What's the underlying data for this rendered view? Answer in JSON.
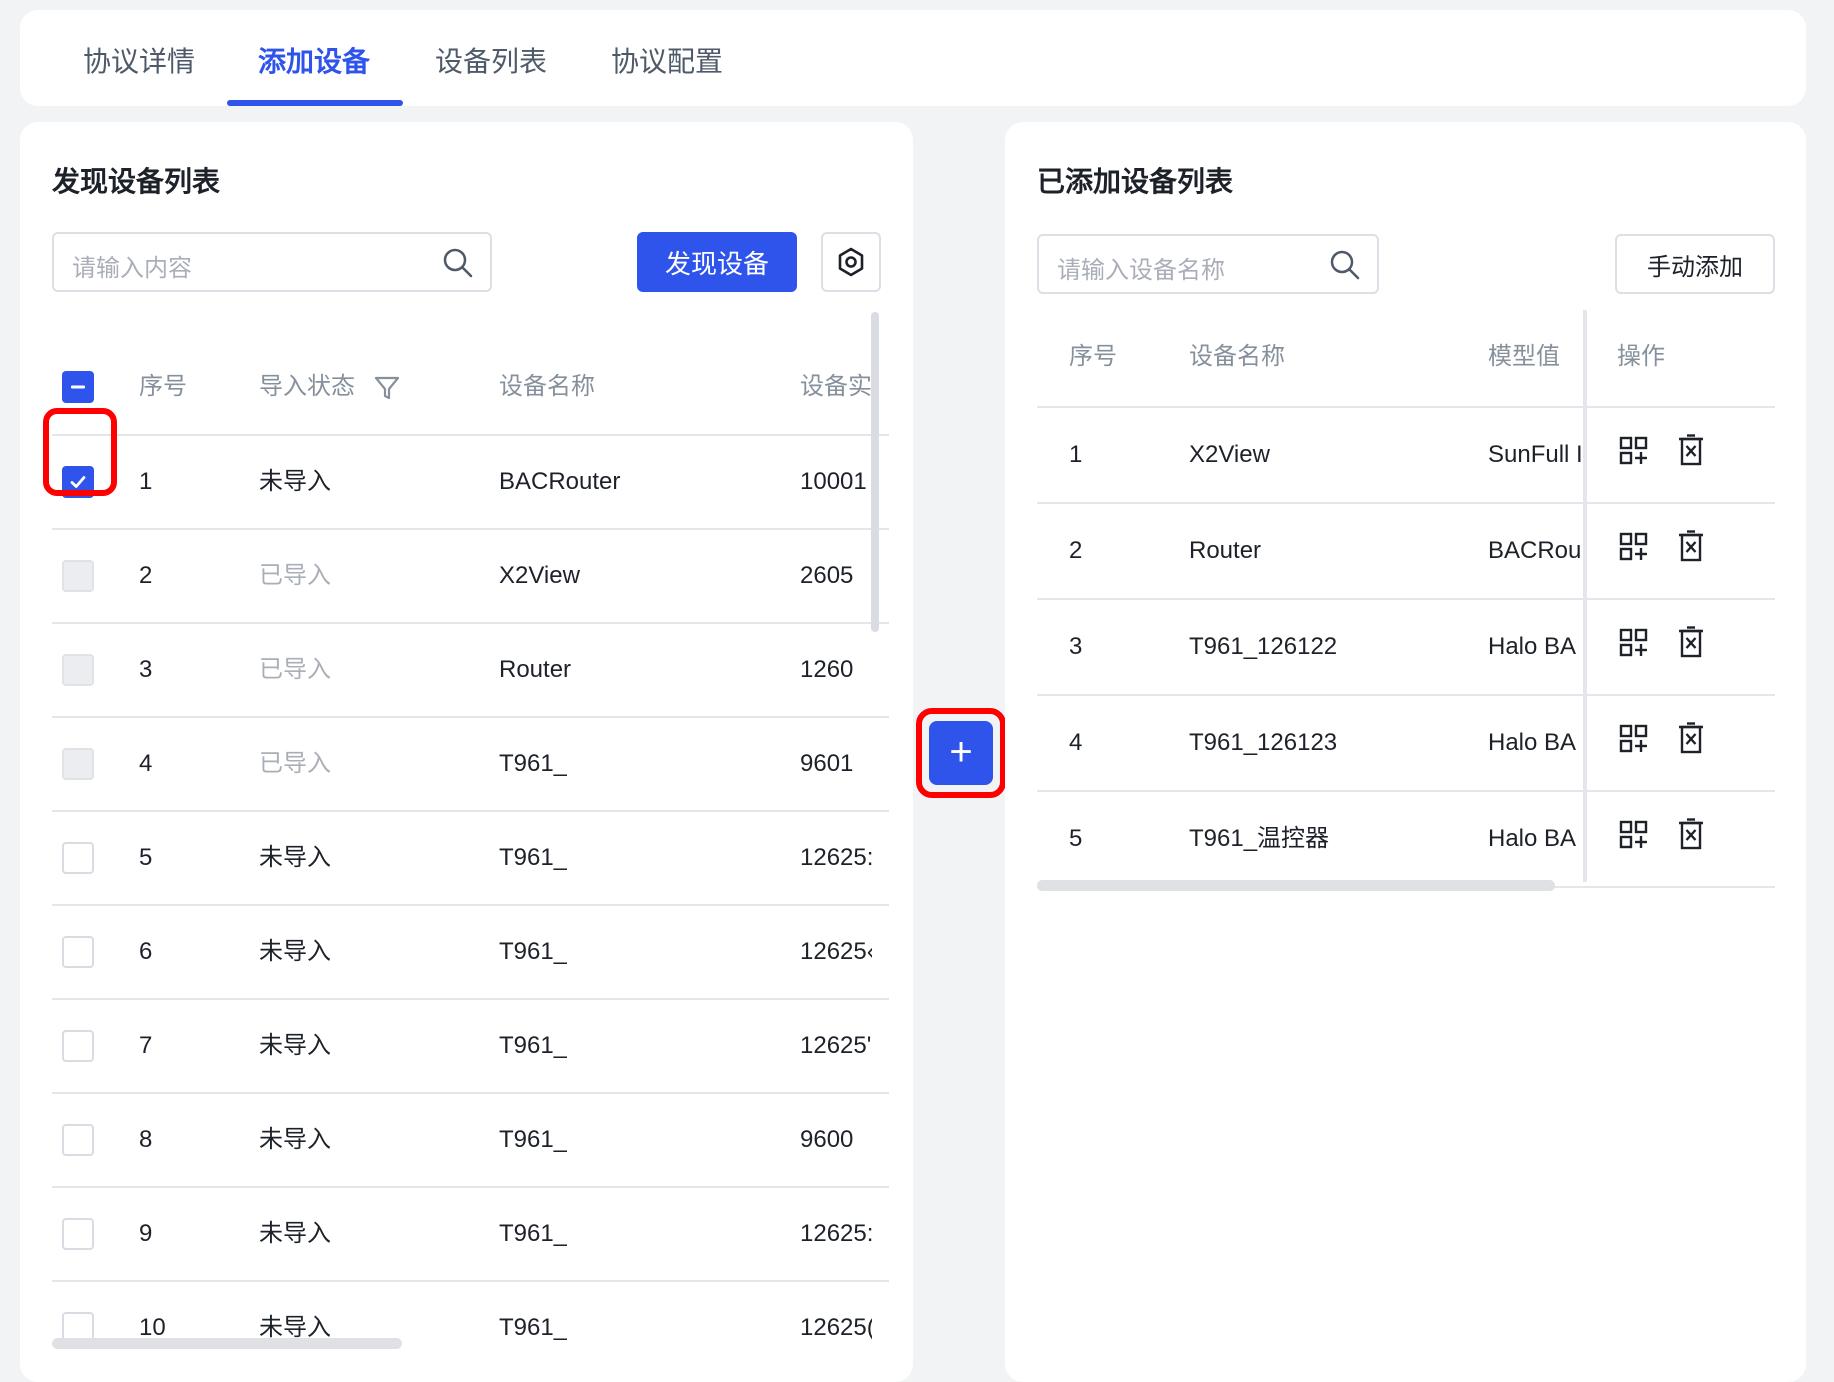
{
  "tabs": [
    {
      "label": "协议详情",
      "active": false
    },
    {
      "label": "添加设备",
      "active": true
    },
    {
      "label": "设备列表",
      "active": false
    },
    {
      "label": "协议配置",
      "active": false
    }
  ],
  "left_panel": {
    "title": "发现设备列表",
    "search_placeholder": "请输入内容",
    "discover_button": "发现设备",
    "settings_icon": "settings-hexagon-icon",
    "columns": [
      "序号",
      "导入状态",
      "设备名称",
      "设备实"
    ],
    "rows": [
      {
        "index": "1",
        "status": "未导入",
        "name": "BACRouter",
        "instance": "10001",
        "checked": true,
        "disabled": false
      },
      {
        "index": "2",
        "status": "已导入",
        "name": "X2View",
        "instance": "2605",
        "checked": false,
        "disabled": true
      },
      {
        "index": "3",
        "status": "已导入",
        "name": "Router",
        "instance": "1260",
        "checked": false,
        "disabled": true
      },
      {
        "index": "4",
        "status": "已导入",
        "name": "T961_",
        "instance": "9601",
        "checked": false,
        "disabled": true
      },
      {
        "index": "5",
        "status": "未导入",
        "name": "T961_",
        "instance": "12625:",
        "checked": false,
        "disabled": false
      },
      {
        "index": "6",
        "status": "未导入",
        "name": "T961_",
        "instance": "12625‹",
        "checked": false,
        "disabled": false
      },
      {
        "index": "7",
        "status": "未导入",
        "name": "T961_",
        "instance": "12625'",
        "checked": false,
        "disabled": false
      },
      {
        "index": "8",
        "status": "未导入",
        "name": "T961_",
        "instance": "9600",
        "checked": false,
        "disabled": false
      },
      {
        "index": "9",
        "status": "未导入",
        "name": "T961_",
        "instance": "12625:",
        "checked": false,
        "disabled": false
      },
      {
        "index": "10",
        "status": "未导入",
        "name": "T961_",
        "instance": "12625(",
        "checked": false,
        "disabled": false
      }
    ]
  },
  "transfer_button": "+",
  "right_panel": {
    "title": "已添加设备列表",
    "search_placeholder": "请输入设备名称",
    "manual_add_button": "手动添加",
    "columns": [
      "序号",
      "设备名称",
      "模型值",
      "操作"
    ],
    "rows": [
      {
        "index": "1",
        "name": "X2View",
        "model": "SunFull I"
      },
      {
        "index": "2",
        "name": "Router",
        "model": "BACRou"
      },
      {
        "index": "3",
        "name": "T961_126122",
        "model": "Halo BA"
      },
      {
        "index": "4",
        "name": "T961_126123",
        "model": "Halo BA"
      },
      {
        "index": "5",
        "name": "T961_温控器",
        "model": "Halo BA"
      }
    ],
    "row_action_icons": [
      "qr-add-icon",
      "delete-icon"
    ]
  },
  "colors": {
    "accent": "#2f54eb",
    "highlight": "#ff0000",
    "background": "#f2f3f5"
  }
}
